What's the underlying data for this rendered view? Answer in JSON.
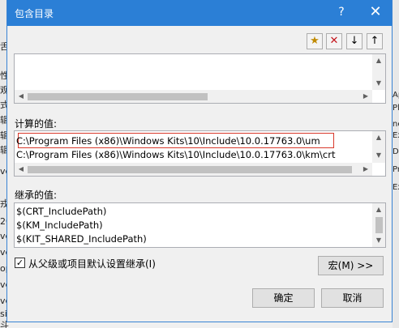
{
  "background": {
    "left_chars": [
      "舌",
      "性",
      "观",
      "式",
      "辑",
      "辑",
      "辑",
      "ve",
      "戎",
      "20",
      "ve",
      "ve",
      "op",
      "ve",
      "ve",
      "si",
      "斗"
    ],
    "right_chars": [
      "Ap",
      "Pl",
      "ne",
      "Ex",
      "D",
      "Pr",
      "Ex"
    ]
  },
  "dialog": {
    "title": "包含目录",
    "help_label": "?",
    "close_label": "✕"
  },
  "toolbar": {
    "new_icon": "★",
    "delete_icon": "✕",
    "down_icon": "↓",
    "up_icon": "↑"
  },
  "evaluated": {
    "label": "计算的值:",
    "items": [
      "C:\\Program Files (x86)\\Windows Kits\\10\\Include\\10.0.17763.0\\um",
      "C:\\Program Files (x86)\\Windows Kits\\10\\Include\\10.0.17763.0\\km\\crt"
    ]
  },
  "inherited": {
    "label": "继承的值:",
    "items": [
      "$(CRT_IncludePath)",
      "$(KM_IncludePath)",
      "$(KIT_SHARED_IncludePath)"
    ]
  },
  "inherit_checkbox": {
    "checked": true,
    "check_glyph": "✓",
    "label": "从父级或项目默认设置继承(I)"
  },
  "buttons": {
    "macro": "宏(M) >>",
    "ok": "确定",
    "cancel": "取消"
  },
  "arrows": {
    "up": "▲",
    "down": "▼",
    "left": "◀",
    "right": "▶"
  }
}
